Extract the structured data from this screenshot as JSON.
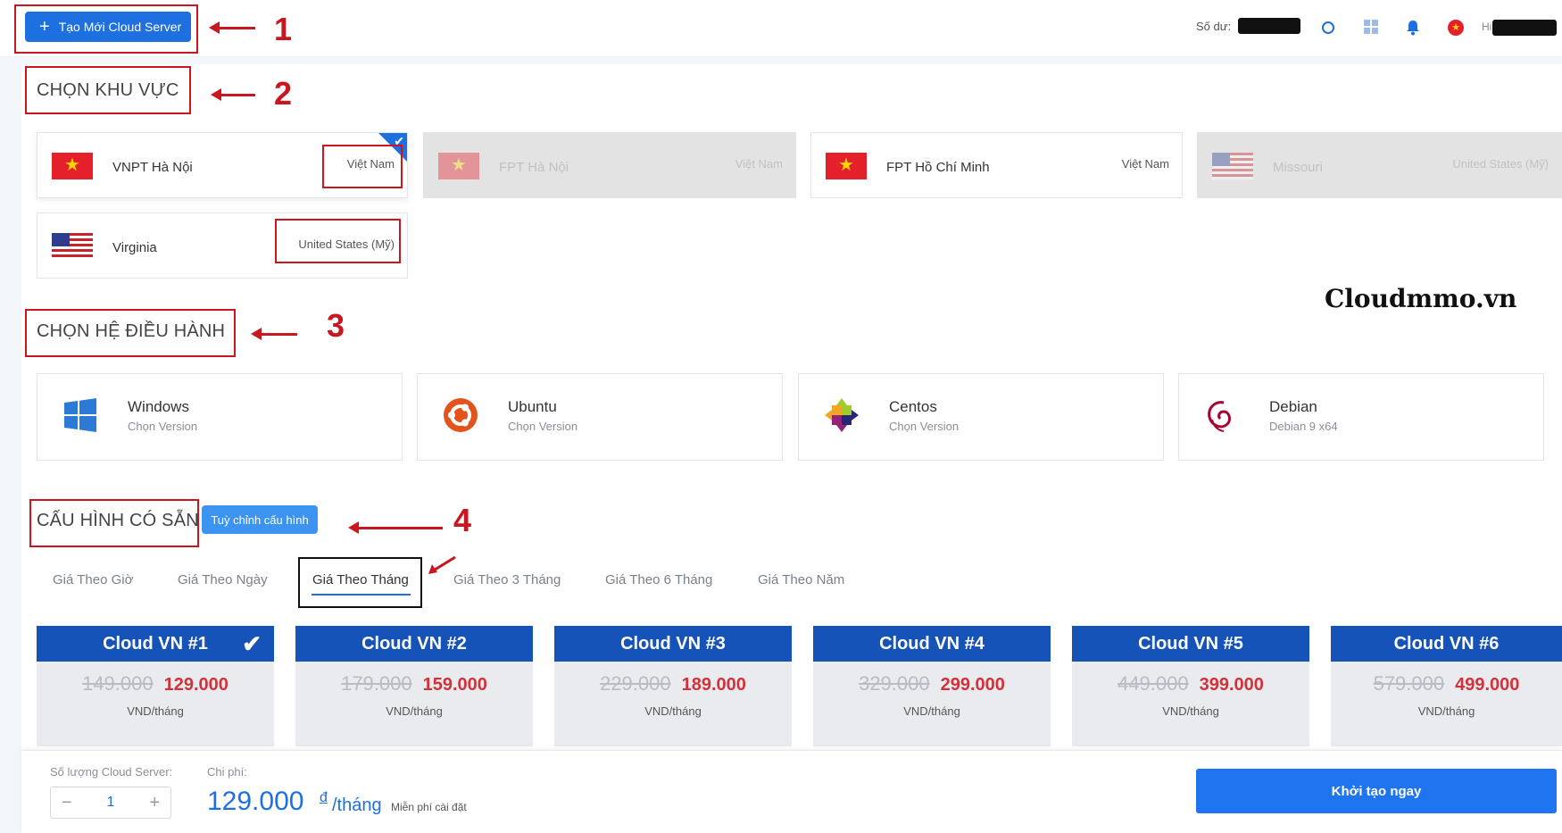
{
  "header": {
    "create_button": "Tạo Mới Cloud Server",
    "balance_label": "Số dư:",
    "greeting": "Hi"
  },
  "annotations": [
    "1",
    "2",
    "3",
    "4"
  ],
  "region_section": {
    "title": "CHỌN KHU VỰC",
    "regions": [
      {
        "name": "VNPT Hà Nội",
        "country": "Việt Nam",
        "flag": "vn-flag",
        "state": "selected"
      },
      {
        "name": "FPT Hà Nội",
        "country": "Việt Nam",
        "flag": "vn-flag",
        "state": "disabled"
      },
      {
        "name": "FPT Hồ Chí Minh",
        "country": "Việt Nam",
        "flag": "vn-flag",
        "state": "available"
      },
      {
        "name": "Missouri",
        "country": "United States (Mỹ)",
        "flag": "us-flag",
        "state": "disabled"
      },
      {
        "name": "Virginia",
        "country": "United States (Mỹ)",
        "flag": "us-flag",
        "state": "available"
      }
    ]
  },
  "watermark": "Cloudmmo.vn",
  "os_section": {
    "title": "CHỌN HỆ ĐIỀU HÀNH",
    "items": [
      {
        "name": "Windows",
        "version": "Chọn Version",
        "icon": "windows-icon"
      },
      {
        "name": "Ubuntu",
        "version": "Chọn Version",
        "icon": "ubuntu-icon"
      },
      {
        "name": "Centos",
        "version": "Chọn Version",
        "icon": "centos-icon"
      },
      {
        "name": "Debian",
        "version": "Debian 9 x64",
        "icon": "debian-icon"
      }
    ]
  },
  "config_section": {
    "title": "CẤU HÌNH CÓ SẴN",
    "custom_button": "Tuỳ chỉnh cấu hình",
    "tabs": [
      "Giá Theo Giờ",
      "Giá Theo Ngày",
      "Giá Theo Tháng",
      "Giá Theo 3 Tháng",
      "Giá Theo 6 Tháng",
      "Giá Theo Năm"
    ],
    "active_tab": "Giá Theo Tháng",
    "plans": [
      {
        "name": "Cloud VN #1",
        "old_price": "149.000",
        "new_price": "129.000",
        "unit": "VND/tháng",
        "selected": true
      },
      {
        "name": "Cloud VN #2",
        "old_price": "179.000",
        "new_price": "159.000",
        "unit": "VND/tháng",
        "selected": false
      },
      {
        "name": "Cloud VN #3",
        "old_price": "229.000",
        "new_price": "189.000",
        "unit": "VND/tháng",
        "selected": false
      },
      {
        "name": "Cloud VN #4",
        "old_price": "329.000",
        "new_price": "299.000",
        "unit": "VND/tháng",
        "selected": false
      },
      {
        "name": "Cloud VN #5",
        "old_price": "449.000",
        "new_price": "399.000",
        "unit": "VND/tháng",
        "selected": false
      },
      {
        "name": "Cloud VN #6",
        "old_price": "579.000",
        "new_price": "499.000",
        "unit": "VND/tháng",
        "selected": false
      }
    ]
  },
  "footer": {
    "quantity_label": "Số lượng Cloud Server:",
    "quantity_value": "1",
    "minus": "−",
    "plus": "+",
    "cost_label": "Chi phí:",
    "cost_value": "129.000",
    "currency": "đ",
    "cost_unit": "/tháng",
    "free_setup": "Miễn phí cài đặt",
    "launch_button": "Khởi tạo ngay"
  },
  "colors": {
    "primary": "#1e6fe0",
    "plan_header": "#1653b8",
    "price_red": "#d3323a",
    "annotation_red": "#c8171e"
  }
}
